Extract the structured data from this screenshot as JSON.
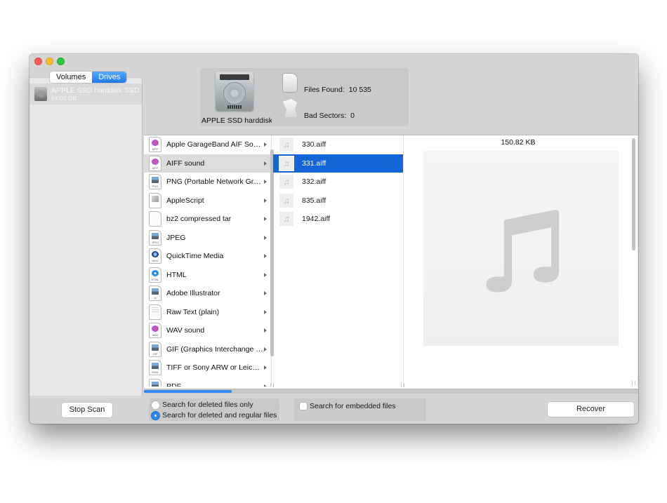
{
  "window": {
    "controls": [
      "close",
      "minimize",
      "maximize"
    ]
  },
  "sidebar": {
    "segments": [
      {
        "label": "Volumes",
        "active": false
      },
      {
        "label": "Drives",
        "active": true
      }
    ],
    "drives": [
      {
        "name": "APPLE SSD harddisk SSD",
        "size": "64.00 GB",
        "icon": "hard-drive-icon"
      }
    ],
    "stop_scan_label": "Stop Scan"
  },
  "summary": {
    "drive_caption": "APPLE SSD harddisk SSD",
    "files_found_label": "Files Found:",
    "files_found_value": "10 535",
    "bad_sectors_label": "Bad Sectors:",
    "bad_sectors_value": "0"
  },
  "file_types": [
    {
      "label": "Apple GarageBand AIF Sound...",
      "icon": "music",
      "ext": "AIFF",
      "selected": false
    },
    {
      "label": "AIFF sound",
      "icon": "music",
      "ext": "AIFF",
      "selected": true
    },
    {
      "label": "PNG (Portable Network Graphi...",
      "icon": "image",
      "ext": "PNG",
      "selected": false
    },
    {
      "label": "AppleScript",
      "icon": "script",
      "ext": "",
      "selected": false
    },
    {
      "label": "bz2 compressed tar",
      "icon": "blank",
      "ext": "",
      "selected": false
    },
    {
      "label": "JPEG",
      "icon": "image",
      "ext": "JPEG",
      "selected": false
    },
    {
      "label": "QuickTime Media",
      "icon": "qt",
      "ext": "MOV",
      "selected": false
    },
    {
      "label": "HTML",
      "icon": "html",
      "ext": "HTML",
      "selected": false
    },
    {
      "label": "Adobe Illustrator",
      "icon": "image",
      "ext": "AI",
      "selected": false
    },
    {
      "label": "Raw Text (plain)",
      "icon": "text",
      "ext": "",
      "selected": false
    },
    {
      "label": "WAV sound",
      "icon": "music",
      "ext": "WAV",
      "selected": false
    },
    {
      "label": "GIF (Graphics Interchange For...",
      "icon": "image",
      "ext": "GIF",
      "selected": false
    },
    {
      "label": "TIFF or Sony ARW or Leica raw...",
      "icon": "image",
      "ext": "RAW",
      "selected": false
    },
    {
      "label": "PDF",
      "icon": "image",
      "ext": "",
      "selected": false
    }
  ],
  "files": [
    {
      "name": "330.aiff",
      "selected": false
    },
    {
      "name": "331.aiff",
      "selected": true
    },
    {
      "name": "332.aiff",
      "selected": false
    },
    {
      "name": "835.aiff",
      "selected": false
    },
    {
      "name": "1942.aiff",
      "selected": false
    }
  ],
  "preview": {
    "size": "150.82 KB",
    "icon": "music-note-icon"
  },
  "options": {
    "radio_deleted_only": "Search for deleted files only",
    "radio_deleted_regular": "Search for deleted and regular files",
    "selected_radio": "deleted_regular",
    "checkbox_embedded": "Search for embedded files",
    "embedded_checked": false
  },
  "recover_label": "Recover",
  "colors": {
    "accent": "#1364d9",
    "segment_active": "#2a86f3",
    "progress": "#2e88f0"
  }
}
